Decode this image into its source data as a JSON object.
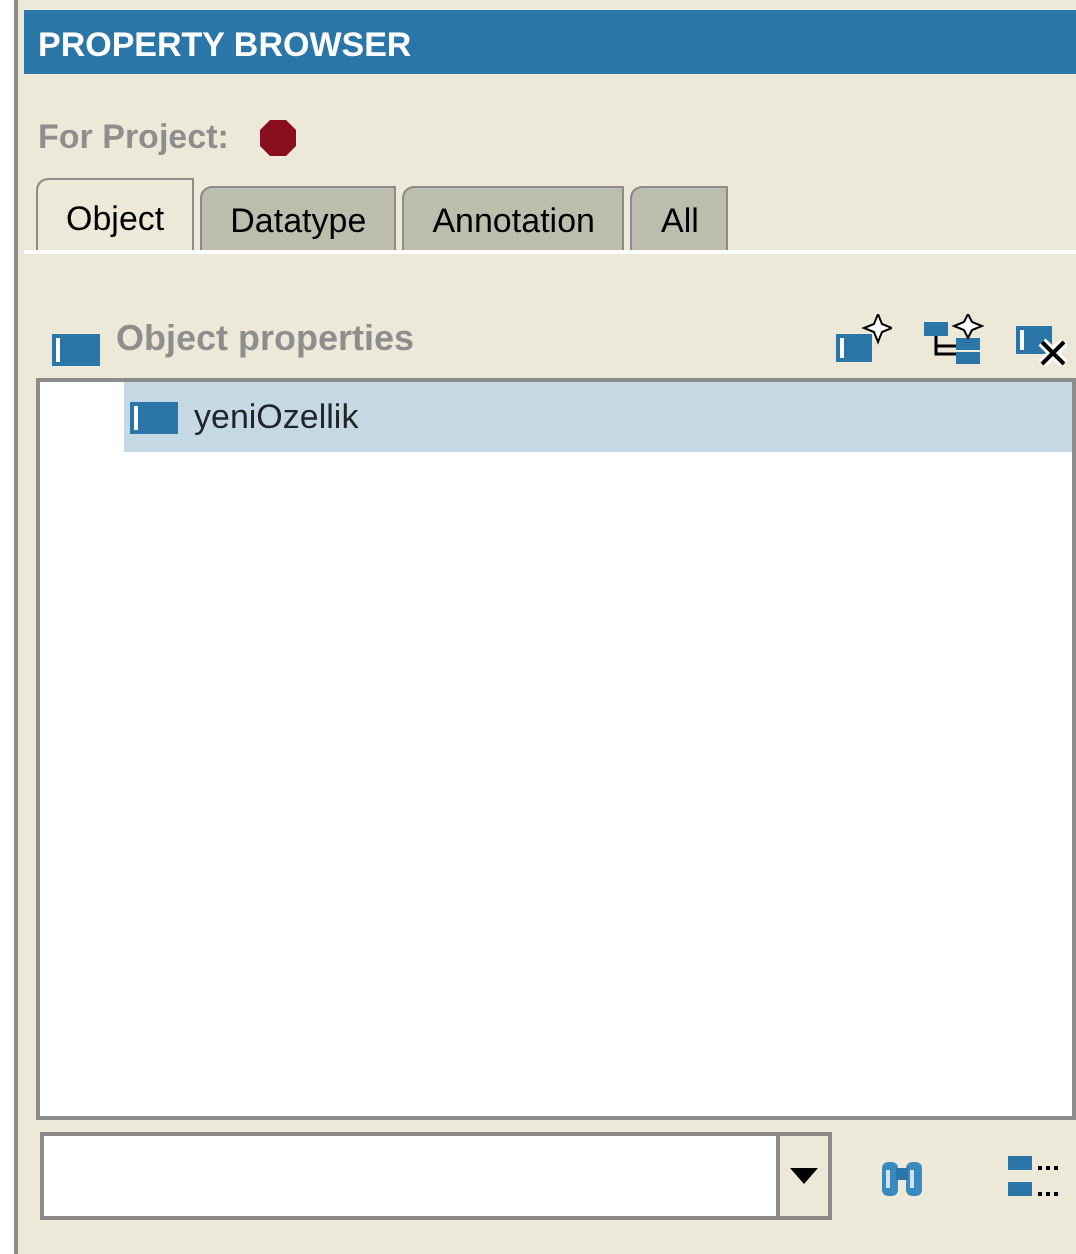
{
  "window": {
    "title": "PROPERTY BROWSER"
  },
  "project": {
    "label": "For Project:"
  },
  "tabs": [
    {
      "label": "Object",
      "selected": true
    },
    {
      "label": "Datatype",
      "selected": false
    },
    {
      "label": "Annotation",
      "selected": false
    },
    {
      "label": "All",
      "selected": false
    }
  ],
  "section": {
    "title": "Object properties"
  },
  "properties": [
    {
      "label": "yeniOzellik",
      "selected": true
    }
  ]
}
